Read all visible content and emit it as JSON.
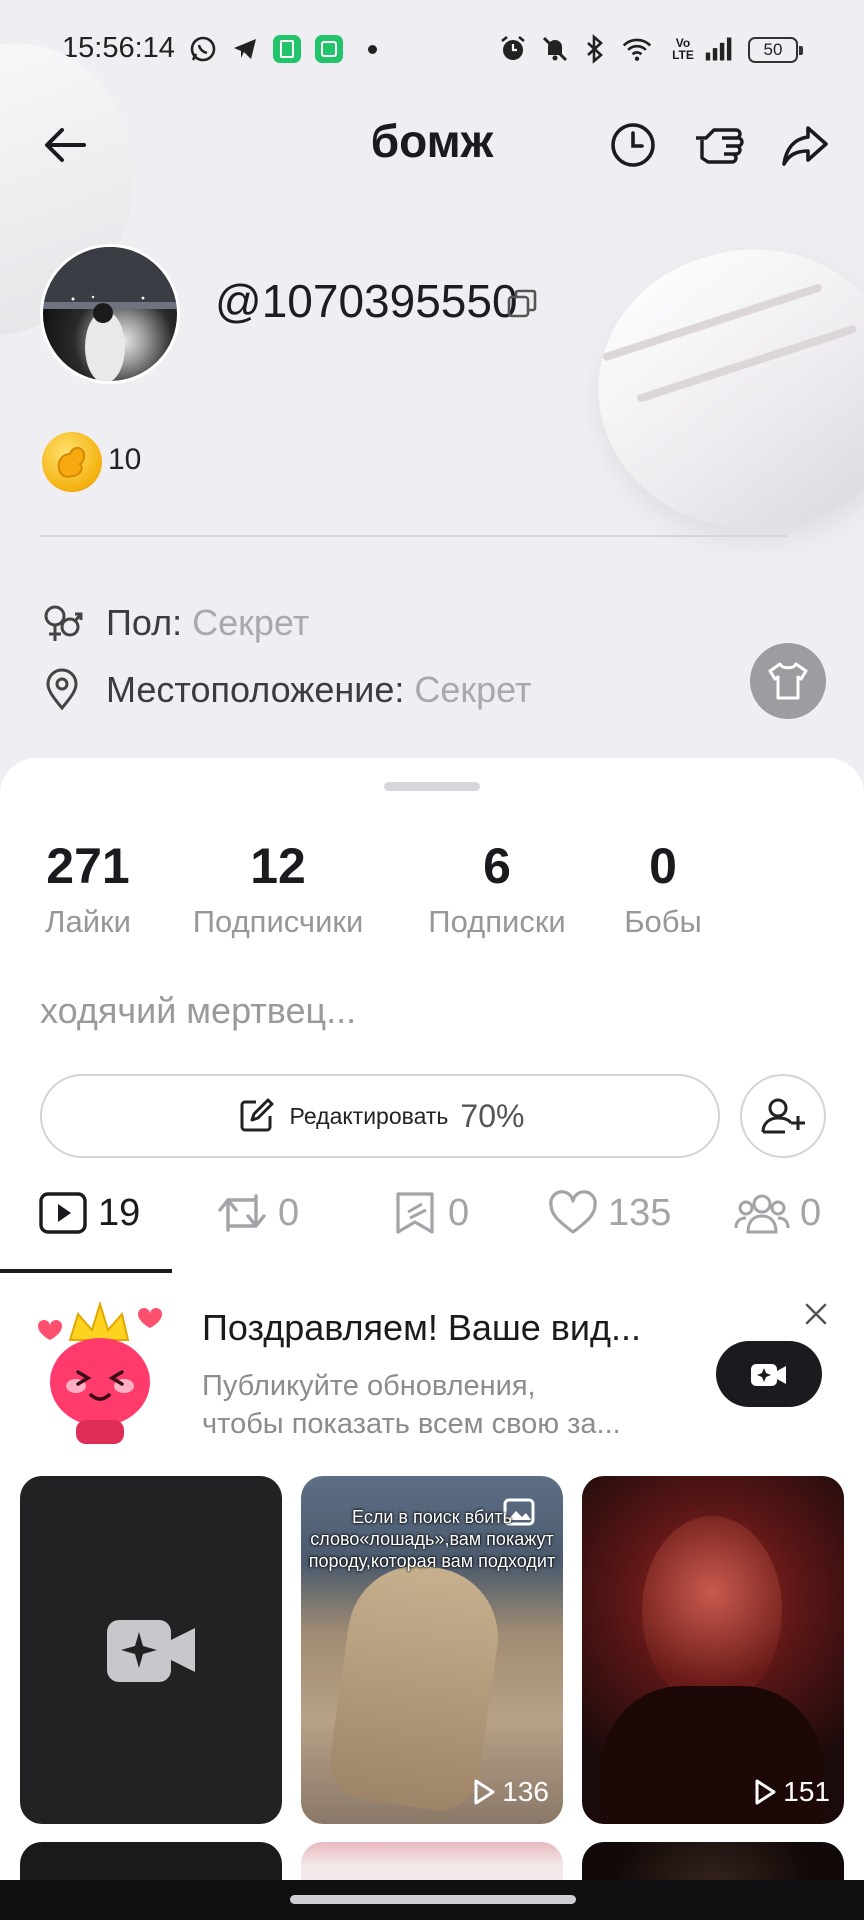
{
  "status_bar": {
    "time": "15:56:14",
    "battery": "50",
    "left_icons": [
      "whatsapp-icon",
      "telegram-icon",
      "app-icon-green",
      "app-icon-green-2",
      "dot-icon"
    ],
    "right_icons": [
      "alarm-icon",
      "mute-icon",
      "bluetooth-icon",
      "wifi-icon",
      "volte-icon",
      "signal-icon",
      "battery-icon"
    ]
  },
  "header": {
    "title": "бомж",
    "icons": [
      "back-arrow-icon",
      "history-icon",
      "gesture-hand-icon",
      "share-icon"
    ]
  },
  "profile": {
    "username": "@1070395550",
    "coins": "10",
    "gender_label": "Пол:",
    "gender_value": "Секрет",
    "location_label": "Местоположение:",
    "location_value": "Секрет"
  },
  "stats": [
    {
      "value": "271",
      "label": "Лайки"
    },
    {
      "value": "12",
      "label": "Подписчики"
    },
    {
      "value": "6",
      "label": "Подписки"
    },
    {
      "value": "0",
      "label": "Бобы"
    }
  ],
  "bio": "ходячий мертвец...",
  "actions": {
    "edit_label": "Редактировать",
    "edit_progress": "70%"
  },
  "tabs": [
    {
      "icon": "video-play-icon",
      "count": "19",
      "active": true
    },
    {
      "icon": "repost-icon",
      "count": "0"
    },
    {
      "icon": "bookmark-icon",
      "count": "0"
    },
    {
      "icon": "heart-icon",
      "count": "135"
    },
    {
      "icon": "group-icon",
      "count": "0"
    }
  ],
  "banner": {
    "title": "Поздравляем! Ваше вид...",
    "subtitle_line1": "Публикуйте обновления,",
    "subtitle_line2": "чтобы показать всем свою за..."
  },
  "videos": [
    {
      "type": "create",
      "icon": "video-camera-sparkle-icon"
    },
    {
      "caption": "Если в поиск вбить слово«лошадь»,вам покажут породу,которая вам подходит",
      "views": "136"
    },
    {
      "views": "151"
    }
  ],
  "colors": {
    "background": "#efeef2",
    "sheet": "#ffffff",
    "text_primary": "#1b1b1f",
    "text_secondary": "#97969b",
    "coin": "#f5b414"
  }
}
